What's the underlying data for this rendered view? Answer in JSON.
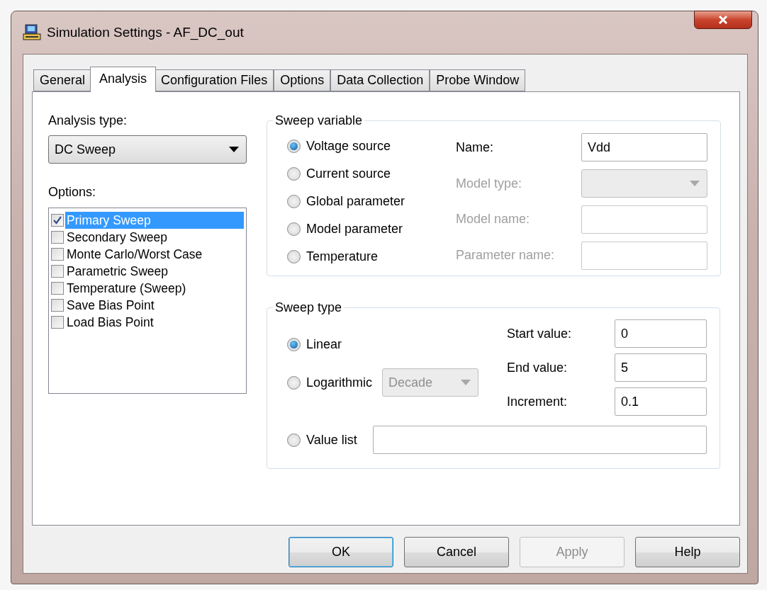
{
  "window": {
    "title": "Simulation Settings - AF_DC_out"
  },
  "tabs": [
    {
      "label": "General",
      "selected": false
    },
    {
      "label": "Analysis",
      "selected": true
    },
    {
      "label": "Configuration Files",
      "selected": false
    },
    {
      "label": "Options",
      "selected": false
    },
    {
      "label": "Data Collection",
      "selected": false
    },
    {
      "label": "Probe Window",
      "selected": false
    }
  ],
  "analysis_type": {
    "label": "Analysis type:",
    "value": "DC Sweep"
  },
  "options": {
    "label": "Options:",
    "items": [
      {
        "label": "Primary Sweep",
        "checked": true,
        "selected": true
      },
      {
        "label": "Secondary Sweep",
        "checked": false,
        "selected": false
      },
      {
        "label": "Monte Carlo/Worst Case",
        "checked": false,
        "selected": false
      },
      {
        "label": "Parametric Sweep",
        "checked": false,
        "selected": false
      },
      {
        "label": "Temperature (Sweep)",
        "checked": false,
        "selected": false
      },
      {
        "label": "Save Bias Point",
        "checked": false,
        "selected": false
      },
      {
        "label": "Load Bias Point",
        "checked": false,
        "selected": false
      }
    ]
  },
  "sweep_variable": {
    "title": "Sweep variable",
    "sources": [
      {
        "label": "Voltage source",
        "selected": true
      },
      {
        "label": "Current source",
        "selected": false
      },
      {
        "label": "Global parameter",
        "selected": false
      },
      {
        "label": "Model parameter",
        "selected": false
      },
      {
        "label": "Temperature",
        "selected": false
      }
    ],
    "fields": [
      {
        "kind": "text",
        "label": "Name:",
        "value": "Vdd",
        "disabled": false
      },
      {
        "kind": "dropdown",
        "label": "Model type:",
        "disabled": true
      },
      {
        "kind": "text",
        "label": "Model name:",
        "disabled": true
      },
      {
        "kind": "text",
        "label": "Parameter name:",
        "disabled": true
      }
    ]
  },
  "sweep_type": {
    "title": "Sweep type",
    "linear": {
      "label": "Linear",
      "selected": true
    },
    "logarithmic": {
      "label": "Logarithmic",
      "selected": false,
      "scale": "Decade",
      "disabled": true
    },
    "value_list": {
      "label": "Value list",
      "selected": false
    },
    "fields": [
      {
        "label": "Start value:",
        "value": "0"
      },
      {
        "label": "End value:",
        "value": "5"
      },
      {
        "label": "Increment:",
        "value": "0.1"
      }
    ]
  },
  "buttons": [
    {
      "label": "OK",
      "default": true,
      "disabled": false
    },
    {
      "label": "Cancel",
      "default": false,
      "disabled": false
    },
    {
      "label": "Apply",
      "default": false,
      "disabled": true
    },
    {
      "label": "Help",
      "default": false,
      "disabled": false
    }
  ]
}
